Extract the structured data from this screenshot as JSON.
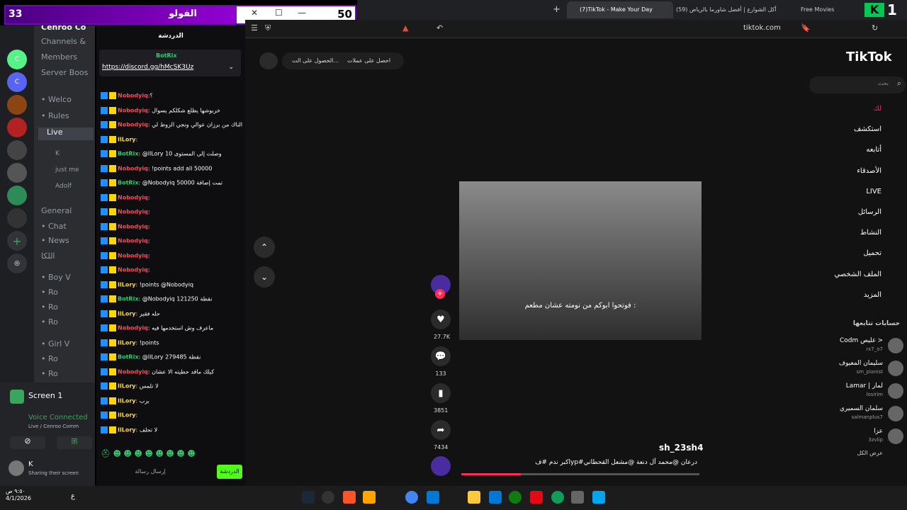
{
  "overlay": {
    "left_count": "33",
    "title": "الفولو",
    "right_count": "50"
  },
  "discord": {
    "server_name": "Cenroo Co",
    "menu": [
      "Channels &",
      "Members",
      "Server Boos"
    ],
    "channels": [
      "• Welco",
      "• Rules",
      "Live",
      "General",
      "• Chat",
      "• News",
      "اللكا",
      "• Boy V",
      "• Ro",
      "• Ro",
      "• Ro",
      "• Girl V",
      "• Ro",
      "• Ro"
    ],
    "voice_users": [
      "K",
      "just me",
      "Adolf"
    ],
    "screen_label": "Screen 1",
    "voice_status": "Voice Connected",
    "voice_sub": "Live / Cenroo Comm",
    "user": {
      "name": "K",
      "status": "Sharing their screen"
    },
    "clock": {
      "time": "٩:٥٠ ص",
      "date": "4/1/2026"
    }
  },
  "chat": {
    "header": "الدردشة",
    "pinned_user": "BotRix",
    "pinned_link": "https://discord.gg/hMcSK3Uz",
    "messages": [
      {
        "user": "Nobodyiq",
        "color": "red",
        "text": ":؟"
      },
      {
        "user": "Nobodyiq",
        "color": "red",
        "text": ": خربوشها يطلع شكلكم يسوال"
      },
      {
        "user": "Nobodyiq",
        "color": "red",
        "text": ": الناك من برزان عوالي ونجي الزوط لي"
      },
      {
        "user": "IlLory",
        "color": "yel",
        "text": ":"
      },
      {
        "user": "BotRix",
        "color": "grn",
        "text": ": @IlLory 10 وصلت إلى المستوى"
      },
      {
        "user": "Nobodyiq",
        "color": "red",
        "text": ": !points add all 50000"
      },
      {
        "user": "BotRix",
        "color": "grn",
        "text": ": @Nobodyiq 50000 تمت إضافة"
      },
      {
        "user": "Nobodyiq",
        "color": "red",
        "text": ":"
      },
      {
        "user": "Nobodyiq",
        "color": "red",
        "text": ":"
      },
      {
        "user": "Nobodyiq",
        "color": "red",
        "text": ":"
      },
      {
        "user": "Nobodyiq",
        "color": "red",
        "text": ":"
      },
      {
        "user": "Nobodyiq",
        "color": "red",
        "text": ":"
      },
      {
        "user": "Nobodyiq",
        "color": "red",
        "text": ":"
      },
      {
        "user": "IlLory",
        "color": "yel",
        "text": ": !points @Nobodyiq"
      },
      {
        "user": "BotRix",
        "color": "grn",
        "text": ": @Nobodyiq 121250 نقطة"
      },
      {
        "user": "IlLory",
        "color": "yel",
        "text": ": حله فقير"
      },
      {
        "user": "Nobodyiq",
        "color": "red",
        "text": ": ماعرف وش استخدمها فيه"
      },
      {
        "user": "IlLory",
        "color": "yel",
        "text": ": !points"
      },
      {
        "user": "BotRix",
        "color": "grn",
        "text": ": @IlLory 279485 نقطة"
      },
      {
        "user": "Nobodyiq",
        "color": "red",
        "text": ": كيلك ماقد حطيته الا عشان"
      },
      {
        "user": "IlLory",
        "color": "yel",
        "text": ": لا تلمس"
      },
      {
        "user": "IlLory",
        "color": "yel",
        "text": ": برب"
      },
      {
        "user": "IlLory",
        "color": "yel",
        "text": ":"
      },
      {
        "user": "IlLory",
        "color": "yel",
        "text": ": لا تحلف"
      }
    ],
    "input_placeholder": "إرسال رسالة",
    "send_label": "الدردشة"
  },
  "browser": {
    "tabs": [
      "(7)TikTok - Make Your Day",
      "(59) أكل الشوارع | أفضل شاورما بالرياض",
      "Free Movies"
    ],
    "url": "tiktok.com"
  },
  "tiktok": {
    "logo": "TikTok",
    "search_placeholder": "بحث",
    "nav": [
      "لك",
      "استكشف",
      "أتابعه",
      "الأصدقاء",
      "LIVE",
      "الرسائل",
      "النشاط",
      "تحميل",
      "الملف الشخصي",
      "المزيد"
    ],
    "following_header": "حسابات تتابعها",
    "following": [
      {
        "name": "Codm غليص >",
        "handle": "rx7_o7"
      },
      {
        "name": "سليمان المعيوف",
        "handle": "sm_planist"
      },
      {
        "name": "Lamar | لمار",
        "handle": "losirim"
      },
      {
        "name": "سلمان السميري",
        "handle": "salmanplus7"
      },
      {
        "name": "عزا",
        "handle": "3zvlip"
      }
    ],
    "see_all": "عرض الكل",
    "top_pills": [
      "احصل على عملات",
      "الحصول على الت..."
    ],
    "video_caption": "فوتحوا ابوكم من نومته عشان مطعم :",
    "counts": {
      "likes": "27.7K",
      "comments": "133",
      "saves": "3851",
      "shares": "7434"
    },
    "author": "sh_23sh4",
    "description": "اكبر ندم #فyp#درعان @محمد آل دنعة @مشعل القحطاني"
  },
  "taskbar": {
    "lang": "ع"
  },
  "colors": {
    "accent": "#fe2c55",
    "chat_bg": "#0e0e10",
    "discord_bg": "#2b2d31"
  }
}
